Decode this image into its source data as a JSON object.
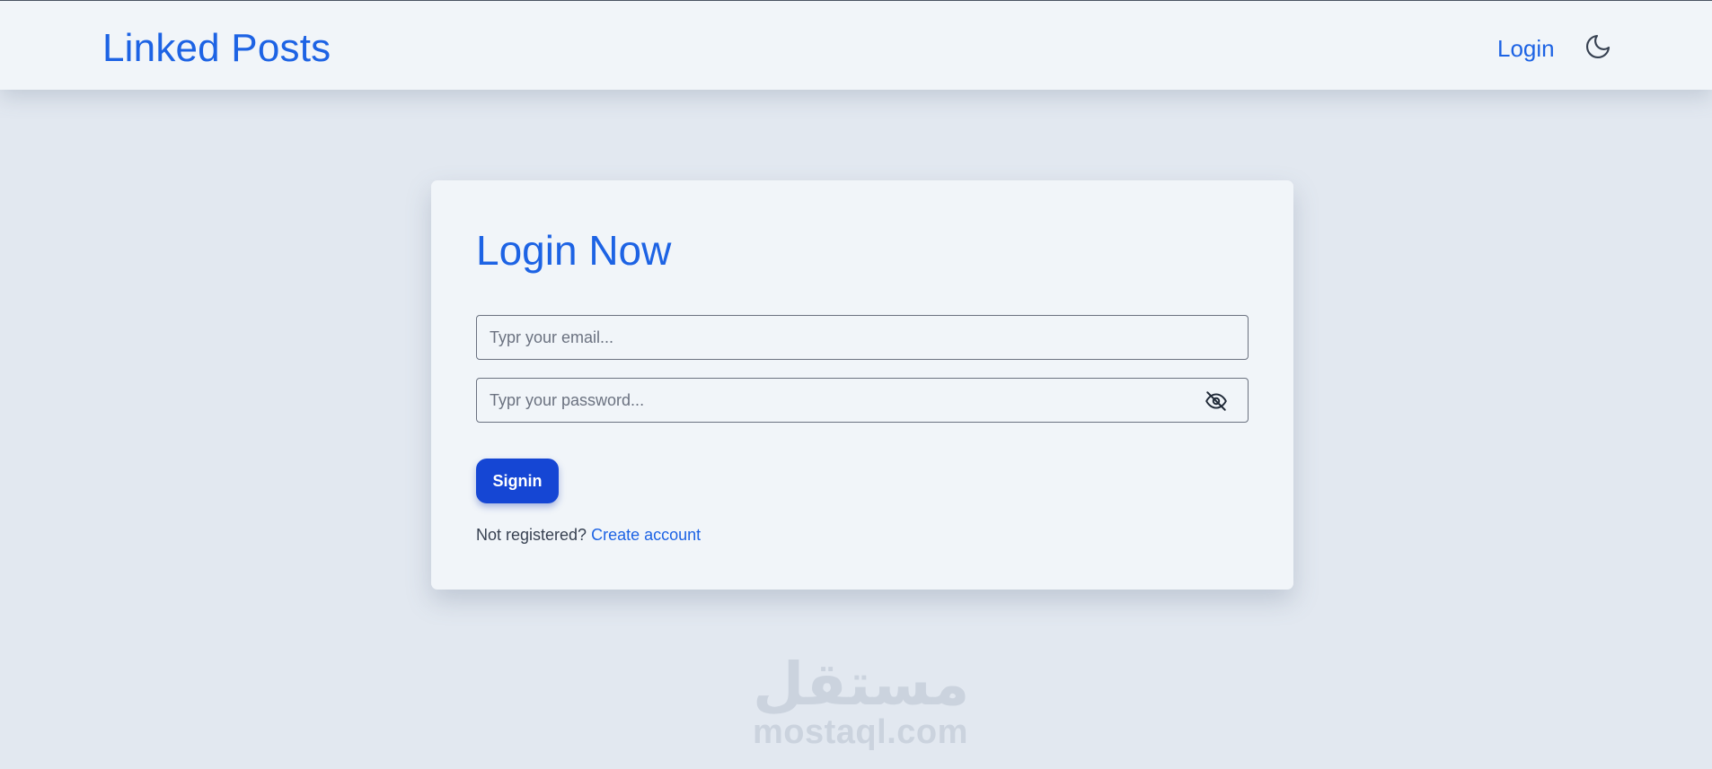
{
  "navbar": {
    "brand": "Linked Posts",
    "login_link": "Login",
    "theme_icon": "moon-icon"
  },
  "login_card": {
    "title": "Login Now",
    "email": {
      "placeholder": "Typr your email...",
      "value": ""
    },
    "password": {
      "placeholder": "Typr your password...",
      "value": "",
      "toggle_icon": "eye-off-icon"
    },
    "signin_label": "Signin",
    "register_prompt": "Not registered?",
    "register_link": "Create account"
  },
  "watermark": {
    "arabic": "مستقل",
    "latin": "mostaql.com"
  },
  "colors": {
    "page_background": "#e2e8f0",
    "surface": "#f1f5f9",
    "accent_blue": "#1d63e4",
    "button_blue": "#1546d4"
  }
}
